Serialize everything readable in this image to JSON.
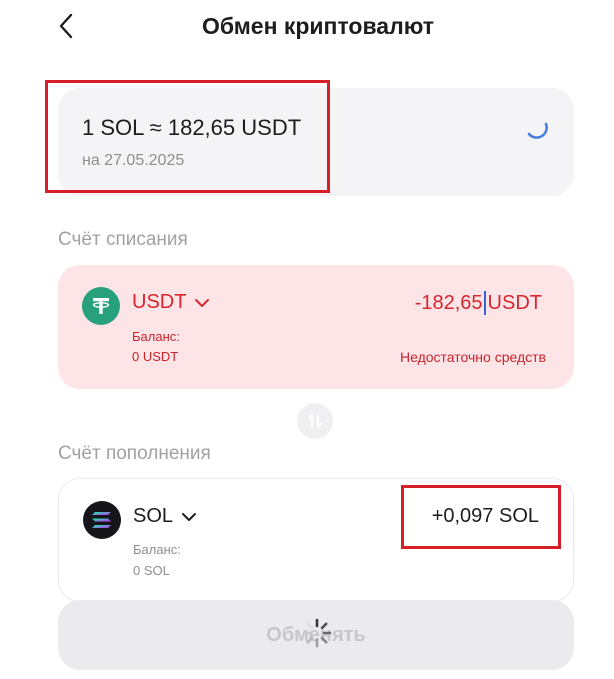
{
  "header": {
    "back_icon": "chevron-left-icon",
    "title": "Обмен криптовалют"
  },
  "rate": {
    "value": "1 SOL ≈ 182,65 USDT",
    "date": "на 27.05.2025",
    "loading_icon": "spinner-icon"
  },
  "debit": {
    "section_label": "Счёт списания",
    "currency": "USDT",
    "coin_icon": "tether-icon",
    "balance_label": "Баланс:",
    "balance_value": "0 USDT",
    "amount_value": "-182,65",
    "amount_currency": "USDT",
    "error_text": "Недостаточно средств",
    "background": "#fde4e6",
    "accent": "#d7262f"
  },
  "swap": {
    "icon": "swap-arrows-icon"
  },
  "credit": {
    "section_label": "Счёт пополнения",
    "currency": "SOL",
    "coin_icon": "solana-icon",
    "balance_label": "Баланс:",
    "balance_value": "0 SOL",
    "amount_value": "+0,097 SOL"
  },
  "exchange_button": {
    "label": "Обменять",
    "state": "disabled",
    "loading_icon": "spinner-icon"
  },
  "colors": {
    "highlight": "#d71f27",
    "caret": "#3b63d9",
    "usdt": "#26a17b",
    "sol_bg": "#16161a"
  }
}
